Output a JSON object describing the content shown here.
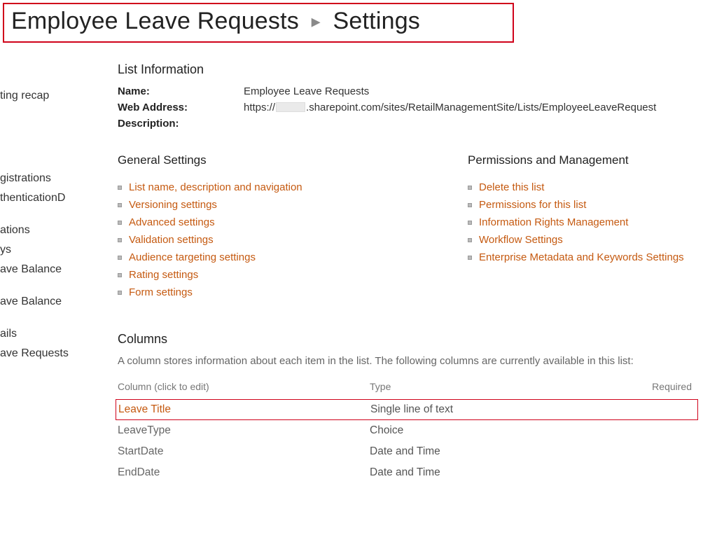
{
  "breadcrumb": {
    "list_name": "Employee Leave Requests",
    "page": "Settings"
  },
  "sidebar": {
    "items": [
      "ting recap",
      "",
      "",
      "",
      "",
      "",
      "gistrations",
      "thenticationD",
      "",
      "ations",
      "ys",
      "ave Balance",
      "",
      "ave Balance",
      "",
      "ails",
      "ave Requests"
    ]
  },
  "list_info": {
    "heading": "List Information",
    "name_label": "Name:",
    "name_value": "Employee Leave Requests",
    "web_label": "Web Address:",
    "web_prefix": "https://",
    "web_suffix": ".sharepoint.com/sites/RetailManagementSite/Lists/EmployeeLeaveRequest",
    "desc_label": "Description:"
  },
  "general": {
    "heading": "General Settings",
    "links": [
      "List name, description and navigation",
      "Versioning settings",
      "Advanced settings",
      "Validation settings",
      "Audience targeting settings",
      "Rating settings",
      "Form settings"
    ]
  },
  "permissions": {
    "heading": "Permissions and Management",
    "links": [
      "Delete this list",
      "Permissions for this list",
      "Information Rights Management",
      "Workflow Settings",
      "Enterprise Metadata and Keywords Settings"
    ]
  },
  "columns": {
    "heading": "Columns",
    "desc": "A column stores information about each item in the list. The following columns are currently available in this list:",
    "th1": "Column (click to edit)",
    "th2": "Type",
    "th3": "Required",
    "rows": [
      {
        "name": "Leave Title",
        "type": "Single line of text",
        "required": "",
        "highlight": true
      },
      {
        "name": "LeaveType",
        "type": "Choice",
        "required": "",
        "highlight": false
      },
      {
        "name": "StartDate",
        "type": "Date and Time",
        "required": "",
        "highlight": false
      },
      {
        "name": "EndDate",
        "type": "Date and Time",
        "required": "",
        "highlight": false
      }
    ]
  }
}
